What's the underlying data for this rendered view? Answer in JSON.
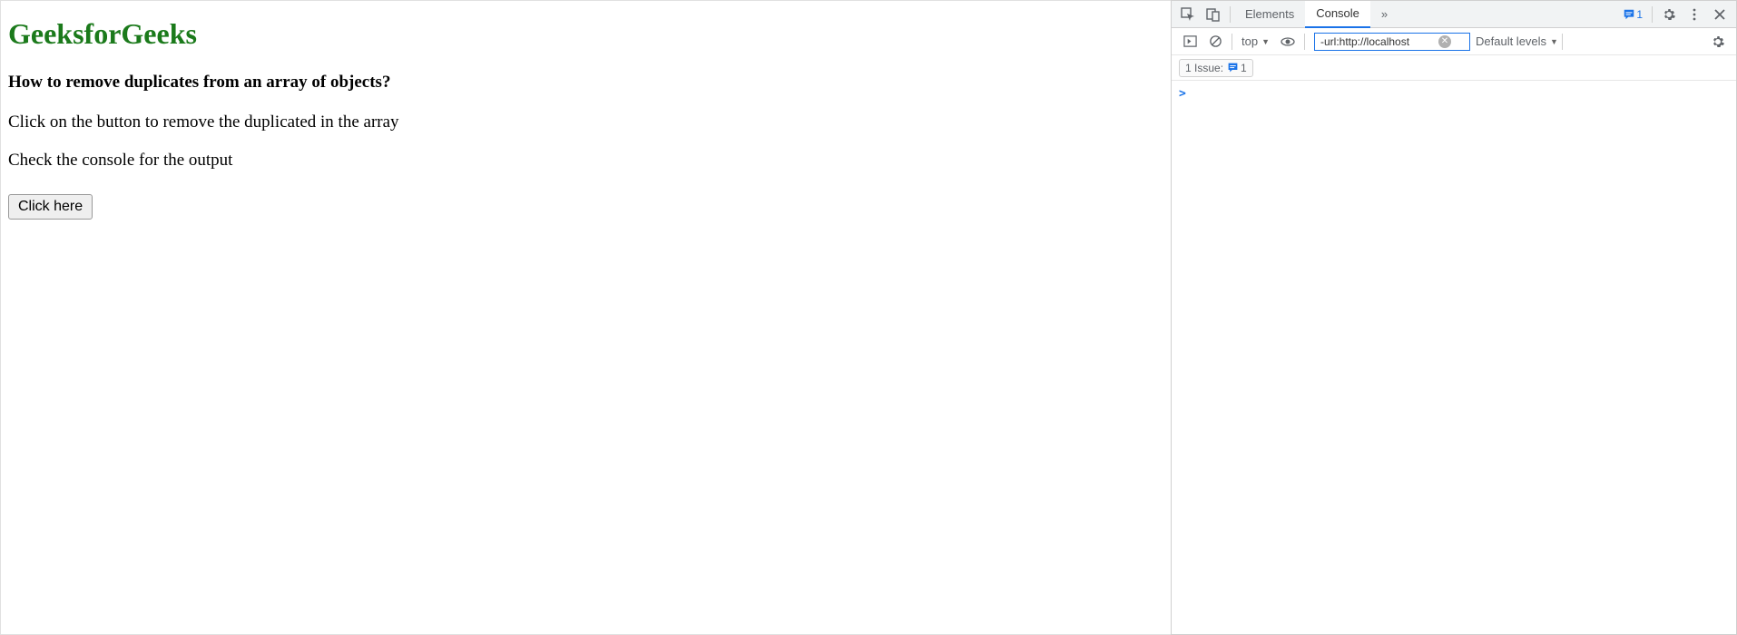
{
  "page": {
    "title": "GeeksforGeeks",
    "subtitle": "How to remove duplicates from an array of objects?",
    "para1": "Click on the button to remove the duplicated in the array",
    "para2": "Check the console for the output",
    "button_label": "Click here"
  },
  "devtools": {
    "tabs": {
      "elements": "Elements",
      "console": "Console",
      "more": "»"
    },
    "msg_badge": "1",
    "context": "top",
    "filter_value": "-url:http://localhost",
    "levels": "Default levels",
    "issues_label": "1 Issue:",
    "issues_count": "1",
    "prompt": ">"
  }
}
